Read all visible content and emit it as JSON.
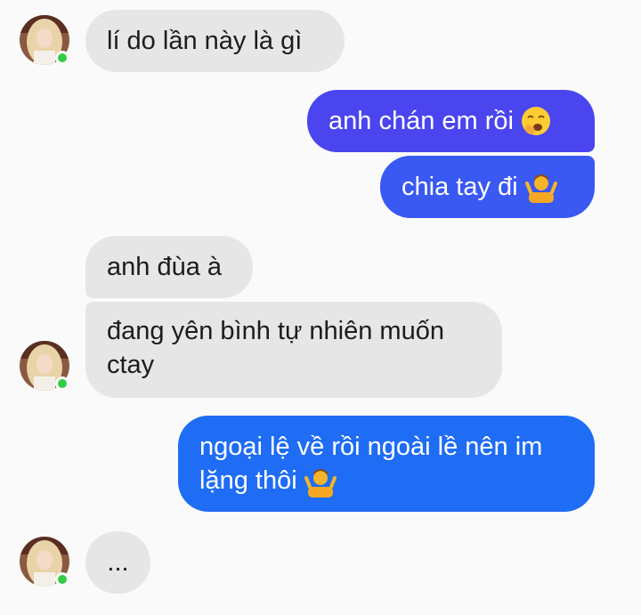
{
  "colors": {
    "incoming_bg": "#e6e6e6",
    "outgoing_top": "#4a45f0",
    "outgoing_bottom": "#1f6cf5",
    "online": "#31cc46",
    "page_bg": "#fafafa"
  },
  "messages": [
    {
      "id": "m1",
      "direction": "incoming",
      "text": "lí do lần này là gì"
    },
    {
      "id": "m2",
      "direction": "outgoing",
      "text": "anh chán em rồi",
      "emoji": "yawning-face-icon"
    },
    {
      "id": "m3",
      "direction": "outgoing",
      "text": "chia tay đi",
      "emoji": "person-shrugging-icon"
    },
    {
      "id": "m4",
      "direction": "incoming",
      "text": "anh đùa à"
    },
    {
      "id": "m5",
      "direction": "incoming",
      "text": "đang yên bình tự nhiên muốn ctay"
    },
    {
      "id": "m6",
      "direction": "outgoing",
      "text": "ngoại lệ về rồi ngoài lề nên im lặng thôi",
      "emoji": "person-shrugging-icon"
    },
    {
      "id": "m7",
      "direction": "incoming",
      "text": "..."
    }
  ],
  "contact": {
    "status": "online"
  }
}
